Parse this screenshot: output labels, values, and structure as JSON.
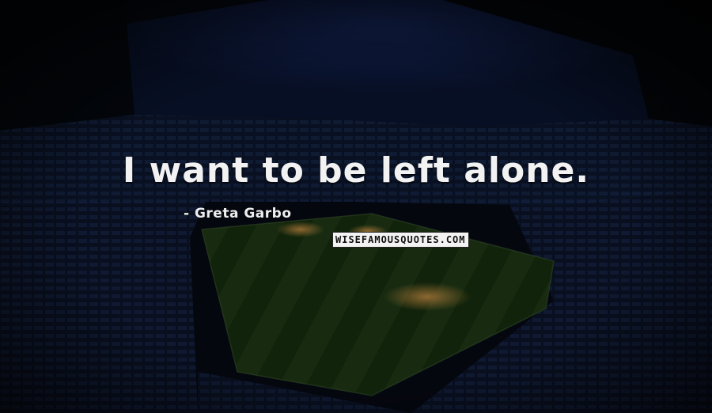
{
  "quote": {
    "text": "I want to be left alone.",
    "author": "- Greta Garbo"
  },
  "watermark": "WISEFAMOUSQUOTES.COM",
  "background": {
    "subject": "stadium-at-night",
    "colors": {
      "sky": "#0b1740",
      "stands": "#0f1a34",
      "pitch": "#1c3316",
      "light_patch": "#d18a3a"
    }
  }
}
